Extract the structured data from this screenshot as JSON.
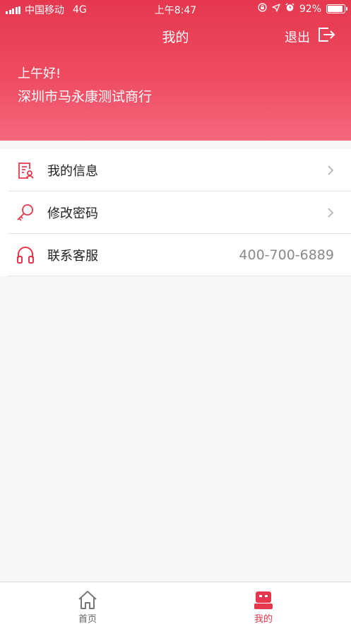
{
  "status_bar": {
    "carrier": "中国移动",
    "network": "4G",
    "time": "上午8:47",
    "battery_percent": "92%",
    "battery_level": 0.92,
    "icons": [
      "signal-icon",
      "orientation-lock-icon",
      "location-arrow-icon",
      "alarm-icon",
      "battery-icon"
    ]
  },
  "header": {
    "title": "我的",
    "logout_label": "退出",
    "logout_icon": "logout-icon",
    "greeting": "上午好!",
    "company": "深圳市马永康测试商行"
  },
  "menu": {
    "items": [
      {
        "label": "我的信息",
        "icon": "profile-document-icon",
        "accessory": "chevron-right-icon"
      },
      {
        "label": "修改密码",
        "icon": "key-icon",
        "accessory": "chevron-right-icon"
      },
      {
        "label": "联系客服",
        "icon": "headphones-icon",
        "value": "400-700-6889"
      }
    ]
  },
  "tab_bar": {
    "tabs": [
      {
        "label": "首页",
        "icon": "home-icon",
        "active": false
      },
      {
        "label": "我的",
        "icon": "profile-robot-icon",
        "active": true
      }
    ]
  },
  "colors": {
    "accent": "#e5384e",
    "header_gradient_start": "#e5384e",
    "header_gradient_end": "#f6687c",
    "inactive_tab": "#666666",
    "secondary_text": "#8a8a8a"
  }
}
